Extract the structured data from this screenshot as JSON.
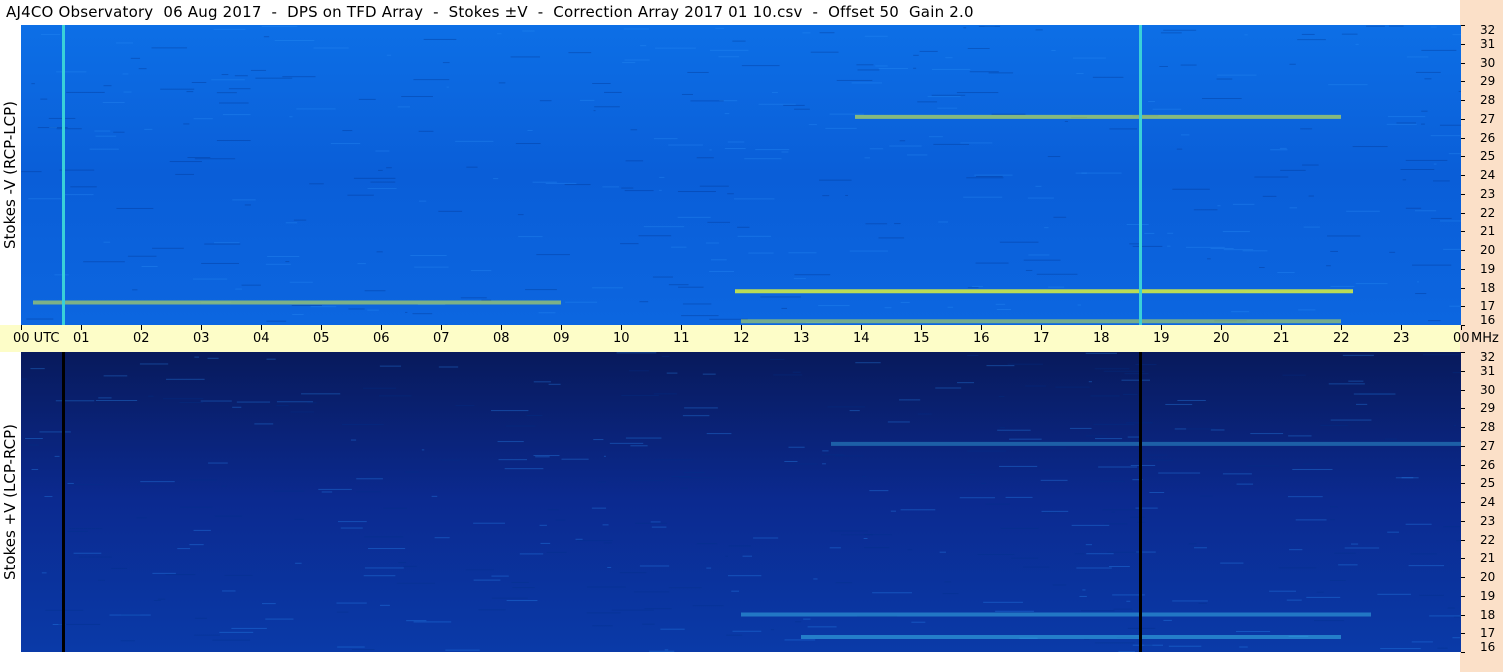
{
  "title": "AJ4CO Observatory  06 Aug 2017  -  DPS on TFD Array  -  Stokes ±V  -  Correction Array 2017 01 10.csv  -  Offset 50  Gain 2.0",
  "colors": {
    "top_base": "#0a63e0",
    "bottom_base": "#0b2a8c",
    "axis_bg": "#fdfdc8",
    "freq_strip_bg": "#fbe0c8"
  },
  "chart_data": [
    {
      "type": "heatmap",
      "title": "",
      "ylabel": "Stokes -V (RCP-LCP)",
      "xlabel": "",
      "x_unit": "UTC",
      "y_unit": "MHz",
      "xlim": [
        0,
        24
      ],
      "ylim": [
        16,
        32
      ],
      "yticks": [
        "32",
        "31",
        "30",
        "29",
        "28",
        "27",
        "26",
        "25",
        "24",
        "23",
        "22",
        "21",
        "20",
        "19",
        "18",
        "17",
        "16"
      ],
      "features": [
        {
          "kind": "band",
          "mhz": 27.1,
          "t_start": 13.9,
          "t_end": 22.0,
          "intensity": 0.6
        },
        {
          "kind": "band",
          "mhz": 17.8,
          "t_start": 11.9,
          "t_end": 22.2,
          "intensity": 0.85
        },
        {
          "kind": "band",
          "mhz": 17.2,
          "t_start": 0.2,
          "t_end": 9.0,
          "intensity": 0.55
        },
        {
          "kind": "band",
          "mhz": 16.2,
          "t_start": 12.0,
          "t_end": 22.0,
          "intensity": 0.5
        },
        {
          "kind": "vline",
          "t": 0.7
        },
        {
          "kind": "vline",
          "t": 18.65
        }
      ]
    },
    {
      "type": "heatmap",
      "title": "",
      "ylabel": "Stokes +V (LCP-RCP)",
      "xlabel": "",
      "x_unit": "UTC",
      "y_unit": "MHz",
      "xlim": [
        0,
        24
      ],
      "ylim": [
        16,
        32
      ],
      "yticks": [
        "32",
        "31",
        "30",
        "29",
        "28",
        "27",
        "26",
        "25",
        "24",
        "23",
        "22",
        "21",
        "20",
        "19",
        "18",
        "17",
        "16"
      ],
      "features": [
        {
          "kind": "band",
          "mhz": 27.1,
          "t_start": 13.5,
          "t_end": 24.0,
          "intensity": 0.4
        },
        {
          "kind": "band",
          "mhz": 18.0,
          "t_start": 12.0,
          "t_end": 22.5,
          "intensity": 0.5
        },
        {
          "kind": "band",
          "mhz": 16.8,
          "t_start": 13.0,
          "t_end": 22.0,
          "intensity": 0.55
        },
        {
          "kind": "vline",
          "t": 0.7
        },
        {
          "kind": "vline",
          "t": 18.65
        }
      ]
    }
  ],
  "time_axis": {
    "first_label": "00  UTC",
    "labels": [
      "01",
      "02",
      "03",
      "04",
      "05",
      "06",
      "07",
      "08",
      "09",
      "10",
      "11",
      "12",
      "13",
      "14",
      "15",
      "16",
      "17",
      "18",
      "19",
      "20",
      "21",
      "22",
      "23"
    ],
    "last_label": "00",
    "unit": "MHz"
  }
}
